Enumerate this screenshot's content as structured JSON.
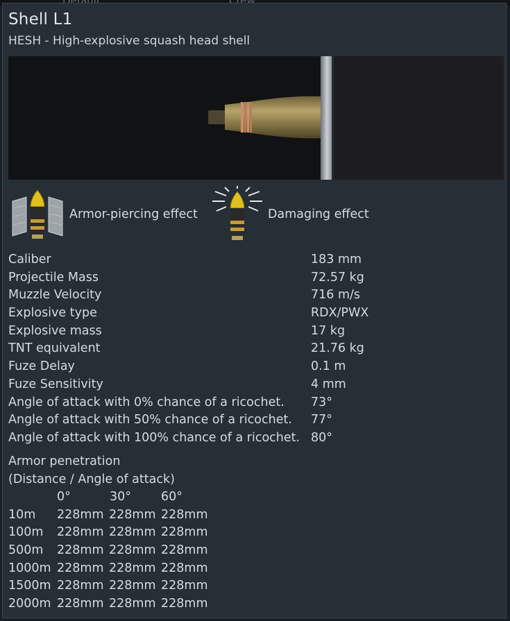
{
  "background": {
    "ghost_left": "Default",
    "ghost_right": "Crew"
  },
  "shell": {
    "title": "Shell L1",
    "subtitle": "HESH - High-explosive squash head shell"
  },
  "effects": {
    "armor_piercing_label": "Armor-piercing effect",
    "damaging_label": "Damaging effect"
  },
  "stats": [
    {
      "label": "Caliber",
      "value": "183 mm"
    },
    {
      "label": "Projectile Mass",
      "value": "72.57 kg"
    },
    {
      "label": "Muzzle Velocity",
      "value": "716 m/s"
    },
    {
      "label": "Explosive type",
      "value": "RDX/PWX"
    },
    {
      "label": "Explosive mass",
      "value": "17 kg"
    },
    {
      "label": "TNT equivalent",
      "value": "21.76 kg"
    },
    {
      "label": "Fuze Delay",
      "value": "0.1 m"
    },
    {
      "label": "Fuze Sensitivity",
      "value": "4 mm"
    },
    {
      "label": "Angle of attack with 0% chance of a ricochet.",
      "value": "73°"
    },
    {
      "label": "Angle of attack with 50% chance of a ricochet.",
      "value": "77°"
    },
    {
      "label": "Angle of attack with 100% chance of a ricochet.",
      "value": "80°"
    }
  ],
  "penetration": {
    "title": "Armor penetration",
    "subtitle": "(Distance / Angle of attack)",
    "angles": [
      "0°",
      "30°",
      "60°"
    ],
    "rows": [
      {
        "distance": "10m",
        "values": [
          "228mm",
          "228mm",
          "228mm"
        ]
      },
      {
        "distance": "100m",
        "values": [
          "228mm",
          "228mm",
          "228mm"
        ]
      },
      {
        "distance": "500m",
        "values": [
          "228mm",
          "228mm",
          "228mm"
        ]
      },
      {
        "distance": "1000m",
        "values": [
          "228mm",
          "228mm",
          "228mm"
        ]
      },
      {
        "distance": "1500m",
        "values": [
          "228mm",
          "228mm",
          "228mm"
        ]
      },
      {
        "distance": "2000m",
        "values": [
          "228mm",
          "228mm",
          "228mm"
        ]
      }
    ]
  },
  "colors": {
    "panel": "#262e36",
    "text": "#d6dbe0",
    "shell_body": "#8a7a4a",
    "shell_tip": "#e4c21a",
    "plate": "#9aa0a6"
  }
}
